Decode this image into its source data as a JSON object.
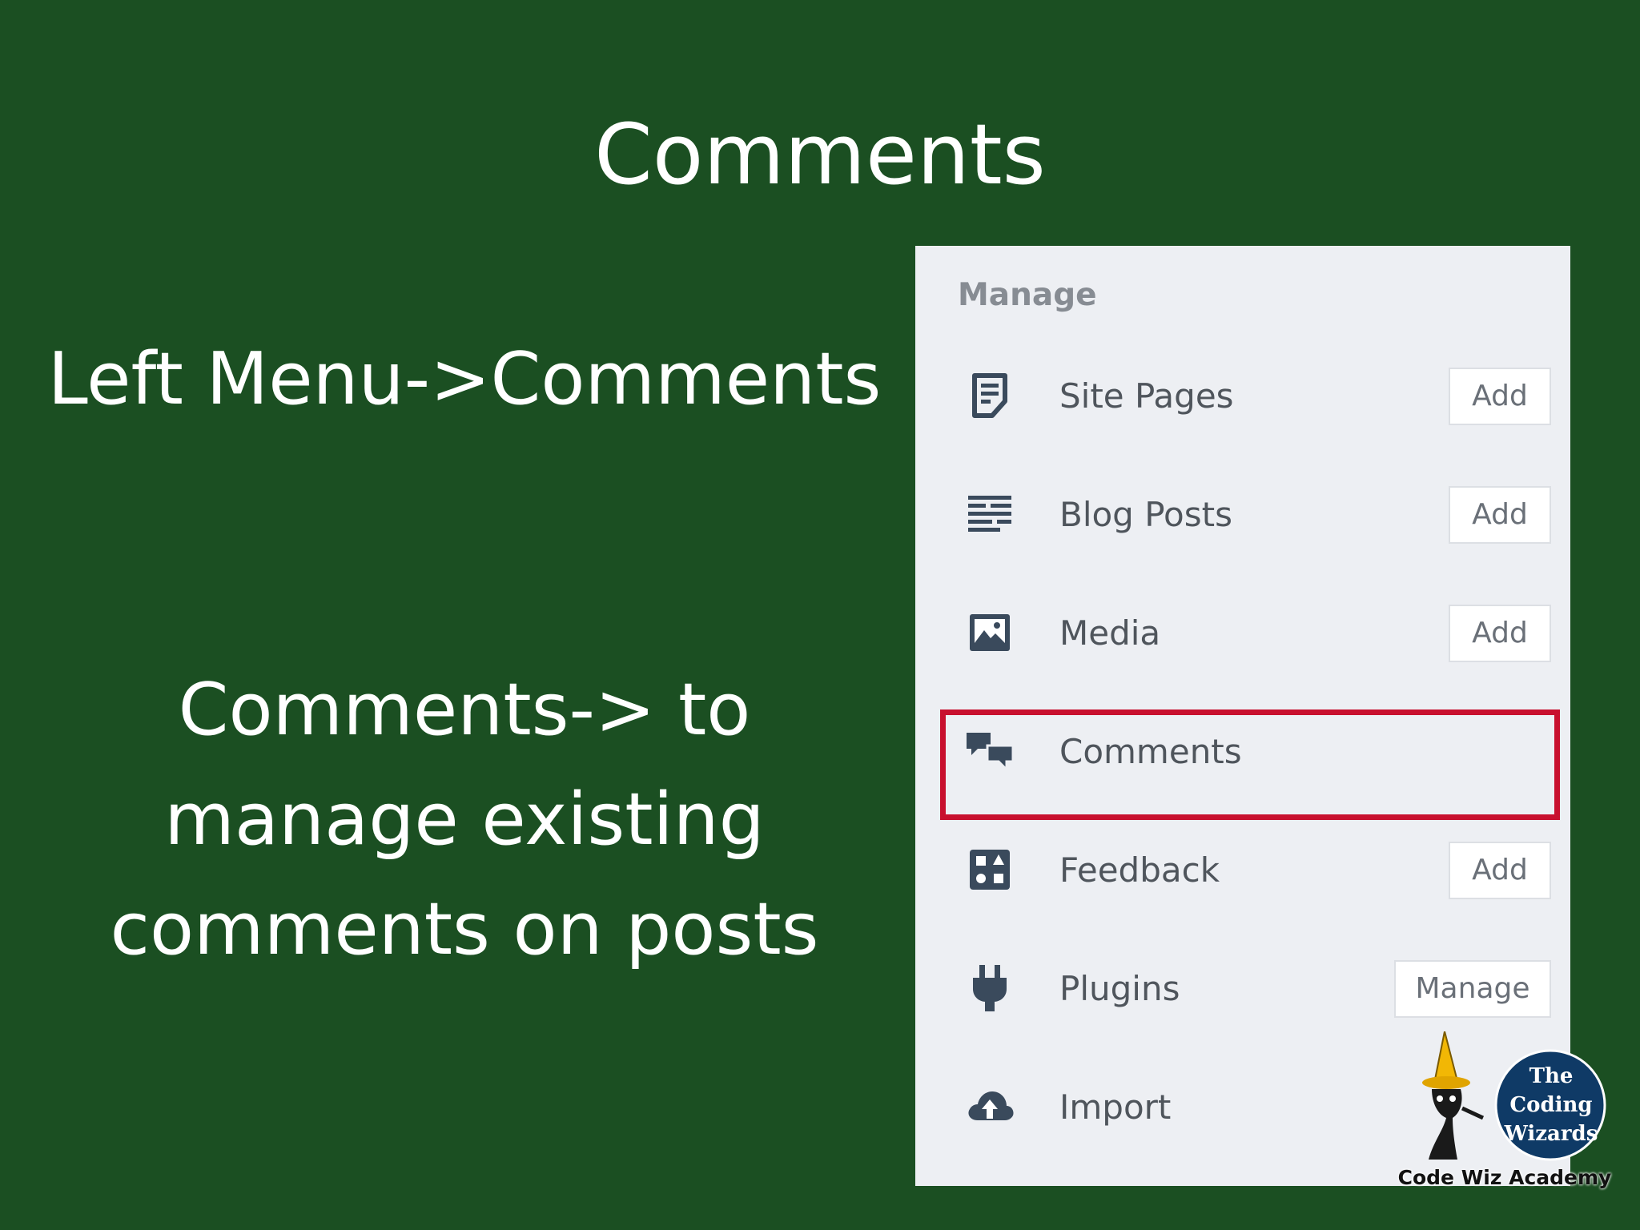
{
  "slide": {
    "title": "Comments",
    "instruction": "Left Menu->Comments",
    "description_lines": [
      "Comments-> to",
      "manage existing",
      "comments on posts"
    ]
  },
  "panel": {
    "heading": "Manage",
    "items": [
      {
        "label": "Site Pages",
        "icon": "site-pages-icon",
        "button": "Add"
      },
      {
        "label": "Blog Posts",
        "icon": "blog-posts-icon",
        "button": "Add"
      },
      {
        "label": "Media",
        "icon": "media-icon",
        "button": "Add"
      },
      {
        "label": "Comments",
        "icon": "comments-icon",
        "button": null,
        "highlighted": true
      },
      {
        "label": "Feedback",
        "icon": "feedback-icon",
        "button": "Add"
      },
      {
        "label": "Plugins",
        "icon": "plugins-icon",
        "button": "Manage"
      },
      {
        "label": "Import",
        "icon": "import-icon",
        "button": null
      }
    ]
  },
  "logo": {
    "circle_lines": [
      "The",
      "Coding",
      "Wizards"
    ],
    "caption": "Code Wiz Academy"
  },
  "colors": {
    "background": "#1b4f22",
    "panel": "#edeff3",
    "highlight": "#c8102e",
    "icon": "#3a4a5c"
  }
}
